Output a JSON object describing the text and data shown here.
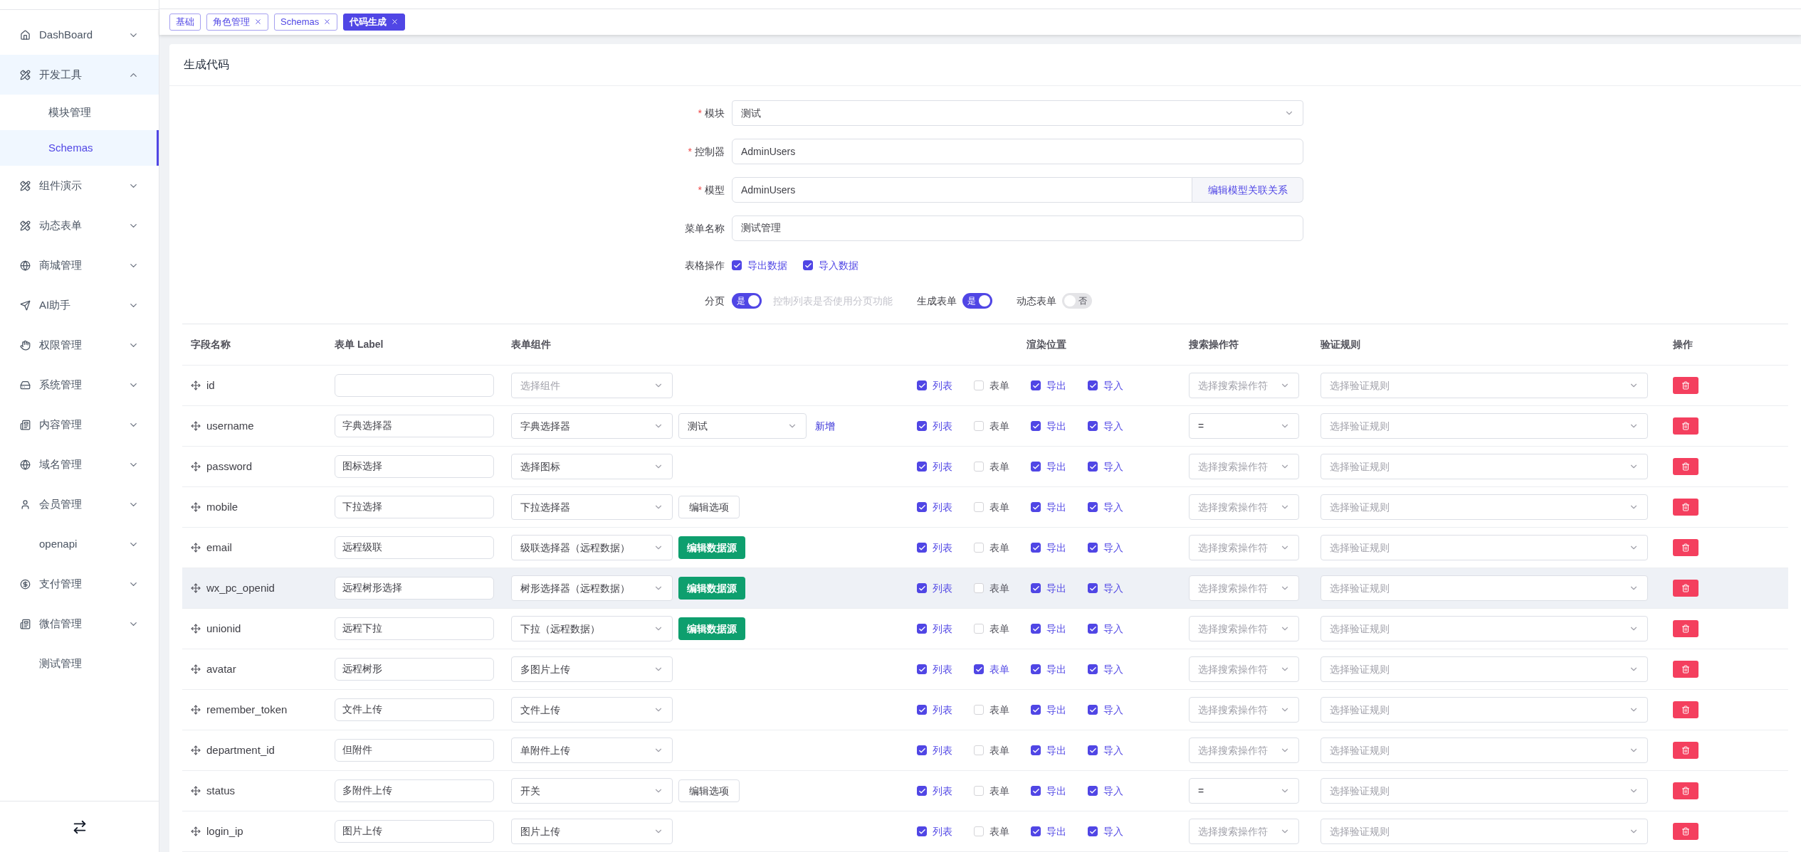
{
  "sidebar": {
    "items": [
      {
        "label": "DashBoard",
        "expanded": false,
        "selected": false
      },
      {
        "label": "开发工具",
        "expanded": true,
        "selected": true,
        "children": [
          {
            "label": "模块管理",
            "selected": false
          },
          {
            "label": "Schemas",
            "selected": true
          }
        ]
      },
      {
        "label": "组件演示",
        "expanded": false,
        "selected": false
      },
      {
        "label": "动态表单",
        "expanded": false,
        "selected": false
      },
      {
        "label": "商城管理",
        "expanded": false,
        "selected": false
      },
      {
        "label": "AI助手",
        "expanded": false,
        "selected": false
      },
      {
        "label": "权限管理",
        "expanded": false,
        "selected": false
      },
      {
        "label": "系统管理",
        "expanded": false,
        "selected": false
      },
      {
        "label": "内容管理",
        "expanded": false,
        "selected": false
      },
      {
        "label": "域名管理",
        "expanded": false,
        "selected": false
      },
      {
        "label": "会员管理",
        "expanded": false,
        "selected": false
      },
      {
        "label": "openapi",
        "expanded": false,
        "selected": false
      },
      {
        "label": "支付管理",
        "expanded": false,
        "selected": false
      },
      {
        "label": "微信管理",
        "expanded": false,
        "selected": false
      },
      {
        "label": "测试管理",
        "selected": false
      }
    ]
  },
  "tabs": [
    {
      "label": "基础",
      "closable": false,
      "selected": false
    },
    {
      "label": "角色管理",
      "closable": true,
      "selected": false
    },
    {
      "label": "Schemas",
      "closable": true,
      "selected": false
    },
    {
      "label": "代码生成",
      "closable": true,
      "selected": true
    }
  ],
  "card": {
    "title": "生成代码"
  },
  "form": {
    "fields": [
      {
        "kind": "select",
        "label": "模块",
        "required_mark": "*",
        "value": "测试"
      },
      {
        "kind": "text",
        "label": "控制器",
        "required_mark": "*",
        "value": "AdminUsers"
      },
      {
        "kind": "text_button",
        "label": "模型",
        "required_mark": "*",
        "value": "AdminUsers",
        "button": "编辑模型关联关系"
      },
      {
        "kind": "text",
        "label": "菜单名称",
        "value": "测试管理"
      }
    ],
    "table_ops": {
      "label": "表格操作",
      "options": [
        {
          "label": "导出数据",
          "checked": true
        },
        {
          "label": "导入数据",
          "checked": true
        }
      ]
    },
    "switches": [
      {
        "label": "分页",
        "on": true,
        "text": "是",
        "hint": "控制列表是否使用分页功能"
      },
      {
        "label": "生成表单",
        "on": true,
        "text": "是"
      },
      {
        "label": "动态表单",
        "on": false,
        "text": "否"
      }
    ]
  },
  "table": {
    "columns": [
      "字段名称",
      "表单 Label",
      "表单组件",
      "渲染位置",
      "搜索操作符",
      "验证规则",
      "操作"
    ],
    "rows": [
      {
        "field": "id",
        "highlighted": false,
        "component_placeholder": "选择组件",
        "render": [
          {
            "label": "列表",
            "checked": true
          },
          {
            "label": "表单",
            "checked": false
          },
          {
            "label": "导出",
            "checked": true
          },
          {
            "label": "导入",
            "checked": true
          }
        ],
        "search_placeholder": "选择搜索操作符",
        "rule_placeholder": "选择验证规则"
      },
      {
        "field": "username",
        "highlighted": false,
        "label": "字典选择器",
        "component": "字典选择器",
        "extra": {
          "kind": "select_link",
          "value": "测试",
          "link": "新增"
        },
        "render": [
          {
            "label": "列表",
            "checked": true
          },
          {
            "label": "表单",
            "checked": false
          },
          {
            "label": "导出",
            "checked": true
          },
          {
            "label": "导入",
            "checked": true
          }
        ],
        "search_value": "=",
        "rule_placeholder": "选择验证规则"
      },
      {
        "field": "password",
        "highlighted": false,
        "label": "图标选择",
        "component": "选择图标",
        "render": [
          {
            "label": "列表",
            "checked": true
          },
          {
            "label": "表单",
            "checked": false
          },
          {
            "label": "导出",
            "checked": true
          },
          {
            "label": "导入",
            "checked": true
          }
        ],
        "search_placeholder": "选择搜索操作符",
        "rule_placeholder": "选择验证规则"
      },
      {
        "field": "mobile",
        "highlighted": false,
        "label": "下拉选择",
        "component": "下拉选择器",
        "extra": {
          "kind": "button",
          "label": "编辑选项"
        },
        "render": [
          {
            "label": "列表",
            "checked": true
          },
          {
            "label": "表单",
            "checked": false
          },
          {
            "label": "导出",
            "checked": true
          },
          {
            "label": "导入",
            "checked": true
          }
        ],
        "search_placeholder": "选择搜索操作符",
        "rule_placeholder": "选择验证规则"
      },
      {
        "field": "email",
        "highlighted": false,
        "label": "远程级联",
        "component": "级联选择器（远程数据）",
        "extra": {
          "kind": "primary_button",
          "label": "编辑数据源"
        },
        "render": [
          {
            "label": "列表",
            "checked": true
          },
          {
            "label": "表单",
            "checked": false
          },
          {
            "label": "导出",
            "checked": true
          },
          {
            "label": "导入",
            "checked": true
          }
        ],
        "search_placeholder": "选择搜索操作符",
        "rule_placeholder": "选择验证规则"
      },
      {
        "field": "wx_pc_openid",
        "highlighted": true,
        "label": "远程树形选择",
        "component": "树形选择器（远程数据）",
        "extra": {
          "kind": "primary_button",
          "label": "编辑数据源"
        },
        "render": [
          {
            "label": "列表",
            "checked": true
          },
          {
            "label": "表单",
            "checked": false
          },
          {
            "label": "导出",
            "checked": true
          },
          {
            "label": "导入",
            "checked": true
          }
        ],
        "search_placeholder": "选择搜索操作符",
        "rule_placeholder": "选择验证规则"
      },
      {
        "field": "unionid",
        "highlighted": false,
        "label": "远程下拉",
        "component": "下拉（远程数据）",
        "extra": {
          "kind": "primary_button",
          "label": "编辑数据源"
        },
        "render": [
          {
            "label": "列表",
            "checked": true
          },
          {
            "label": "表单",
            "checked": false
          },
          {
            "label": "导出",
            "checked": true
          },
          {
            "label": "导入",
            "checked": true
          }
        ],
        "search_placeholder": "选择搜索操作符",
        "rule_placeholder": "选择验证规则"
      },
      {
        "field": "avatar",
        "highlighted": false,
        "label": "远程树形",
        "component": "多图片上传",
        "render": [
          {
            "label": "列表",
            "checked": true
          },
          {
            "label": "表单",
            "checked": true
          },
          {
            "label": "导出",
            "checked": true
          },
          {
            "label": "导入",
            "checked": true
          }
        ],
        "search_placeholder": "选择搜索操作符",
        "rule_placeholder": "选择验证规则"
      },
      {
        "field": "remember_token",
        "highlighted": false,
        "label": "文件上传",
        "component": "文件上传",
        "render": [
          {
            "label": "列表",
            "checked": true
          },
          {
            "label": "表单",
            "checked": false
          },
          {
            "label": "导出",
            "checked": true
          },
          {
            "label": "导入",
            "checked": true
          }
        ],
        "search_placeholder": "选择搜索操作符",
        "rule_placeholder": "选择验证规则"
      },
      {
        "field": "department_id",
        "highlighted": false,
        "label": "但附件",
        "component": "单附件上传",
        "render": [
          {
            "label": "列表",
            "checked": true
          },
          {
            "label": "表单",
            "checked": false
          },
          {
            "label": "导出",
            "checked": true
          },
          {
            "label": "导入",
            "checked": true
          }
        ],
        "search_placeholder": "选择搜索操作符",
        "rule_placeholder": "选择验证规则"
      },
      {
        "field": "status",
        "highlighted": false,
        "label": "多附件上传",
        "component": "开关",
        "extra": {
          "kind": "button",
          "label": "编辑选项"
        },
        "render": [
          {
            "label": "列表",
            "checked": true
          },
          {
            "label": "表单",
            "checked": false
          },
          {
            "label": "导出",
            "checked": true
          },
          {
            "label": "导入",
            "checked": true
          }
        ],
        "search_value": "=",
        "rule_placeholder": "选择验证规则"
      },
      {
        "field": "login_ip",
        "highlighted": false,
        "label": "图片上传",
        "component": "图片上传",
        "render": [
          {
            "label": "列表",
            "checked": true
          },
          {
            "label": "表单",
            "checked": false
          },
          {
            "label": "导出",
            "checked": true
          },
          {
            "label": "导入",
            "checked": true
          }
        ],
        "search_placeholder": "选择搜索操作符",
        "rule_placeholder": "选择验证规则"
      }
    ]
  }
}
